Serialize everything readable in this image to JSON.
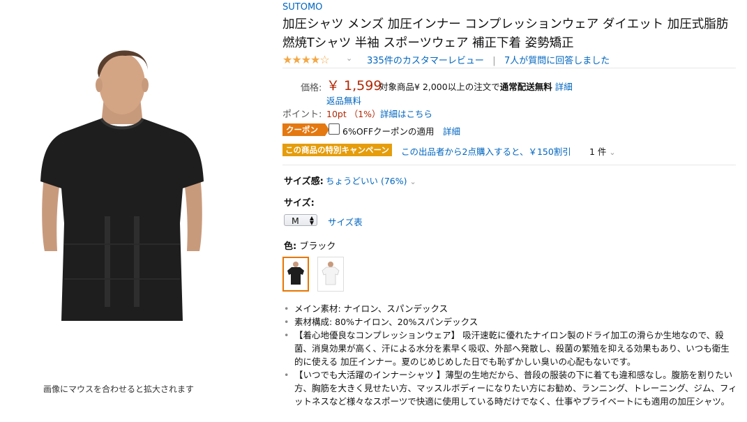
{
  "image": {
    "hover_note": "画像にマウスを合わせると拡大されます"
  },
  "product": {
    "brand": "SUTOMO",
    "title": "加圧シャツ メンズ 加圧インナー コンプレッションウェア ダイエット 加圧式脂肪燃焼Tシャツ 半袖 スポーツウェア 補正下着 姿勢矯正",
    "stars": "★★★★☆",
    "rating_fraction": 0.8,
    "reviews_link": "335件のカスタマーレビュー",
    "separator": "|",
    "questions_link": "7人が質問に回答しました"
  },
  "price": {
    "label": "価格:",
    "value": "￥ 1,599",
    "shipping_note_prefix": "対象商品¥ 2,000以上の注文で",
    "shipping_note_bold": "通常配送無料",
    "shipping_detail": "詳細",
    "free_return": "返品無料"
  },
  "points": {
    "label": "ポイント:",
    "value": "10pt （1%）",
    "detail": "詳細はこちら"
  },
  "coupon": {
    "badge": "クーポン",
    "text": "6%OFFクーポンの適用",
    "detail": "詳細"
  },
  "campaign": {
    "badge": "この商品の特別キャンペーン",
    "text": "この出品者から2点購入すると、￥150割引",
    "count": "1 件"
  },
  "fit": {
    "label": "サイズ感:",
    "value": "ちょうどいい (76%)"
  },
  "size": {
    "label": "サイズ:",
    "selected": "M",
    "chart_link": "サイズ表"
  },
  "color": {
    "label": "色:",
    "selected": "ブラック",
    "swatches": [
      "ブラック",
      "ホワイト"
    ]
  },
  "bullets": [
    "メイン素材: ナイロン、スパンデックス",
    "素材構成: 80%ナイロン、20%スパンデックス",
    "【着心地優良なコンプレッションウェア】 吸汗速乾に優れたナイロン製のドライ加工の滑らか生地なので、殺菌、消臭効果が高く、汗による水分を素早く吸収、外部へ発散し、殺菌の繁殖を抑える効果もあり、いつも衛生的に使える 加圧インナー。夏のじめじめした日でも恥ずかしい臭いの心配もないです。",
    "【いつでも大活躍のインナーシャツ 】薄型の生地だから、普段の服装の下に着ても違和感なし。腹筋を割りたい方、胸筋を大きく見せたい方、マッスルボディーになりたい方にお勧め、ランニング、トレーニング、ジム、フィットネスなど様々なスポーツで快適に使用している時だけでなく、仕事やプライベートにも適用の加圧シャツ。"
  ]
}
